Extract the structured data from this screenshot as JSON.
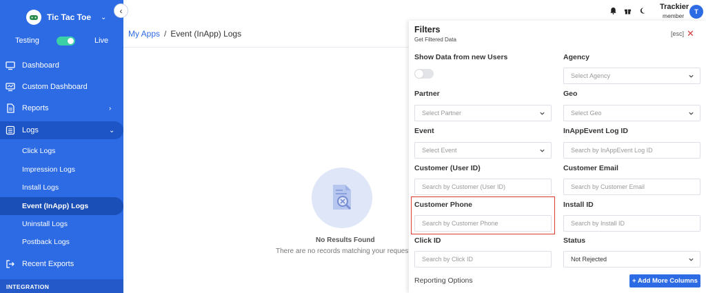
{
  "sidebar": {
    "brand": "Tic Tac Toe",
    "env": {
      "testing": "Testing",
      "live": "Live"
    },
    "nav": {
      "dashboard": "Dashboard",
      "custom_dashboard": "Custom Dashboard",
      "reports": "Reports",
      "logs": "Logs",
      "recent_exports": "Recent Exports"
    },
    "logs_sub": [
      "Click Logs",
      "Impression Logs",
      "Install Logs",
      "Event (InApp) Logs",
      "Uninstall Logs",
      "Postback Logs"
    ],
    "section_integration": "INTEGRATION"
  },
  "header": {
    "user_name": "Trackier",
    "user_role": "member",
    "avatar_initial": "T"
  },
  "breadcrumb": {
    "root": "My Apps",
    "separator": "/",
    "current": "Event (InApp) Logs"
  },
  "empty_state": {
    "title": "No Results Found",
    "subtitle": "There are no records matching your request"
  },
  "filters": {
    "title": "Filters",
    "subtitle": "Get Filtered Data",
    "esc": "[esc]",
    "close": "✕",
    "show_new_users": {
      "label": "Show Data from new Users"
    },
    "agency": {
      "label": "Agency",
      "placeholder": "Select Agency"
    },
    "partner": {
      "label": "Partner",
      "placeholder": "Select Partner"
    },
    "geo": {
      "label": "Geo",
      "placeholder": "Select Geo"
    },
    "event": {
      "label": "Event",
      "placeholder": "Select Event"
    },
    "inapp_log_id": {
      "label": "InAppEvent Log ID",
      "placeholder": "Search by InAppEvent Log ID"
    },
    "customer_user_id": {
      "label": "Customer (User ID)",
      "placeholder": "Search by Customer (User ID)"
    },
    "customer_email": {
      "label": "Customer Email",
      "placeholder": "Search by Customer Email"
    },
    "customer_phone": {
      "label": "Customer Phone",
      "placeholder": "Search by Customer Phone"
    },
    "install_id": {
      "label": "Install ID",
      "placeholder": "Search by Install ID"
    },
    "click_id": {
      "label": "Click ID",
      "placeholder": "Search by Click ID"
    },
    "status": {
      "label": "Status",
      "value": "Not Rejected"
    },
    "reporting_options": "Reporting Options",
    "add_more_columns": "+ Add More Columns"
  },
  "colors": {
    "sidebar_bg": "#2d6be4",
    "accent": "#2d6be4",
    "toggle_on": "#3cd0a6",
    "highlight": "#d93a2a"
  }
}
